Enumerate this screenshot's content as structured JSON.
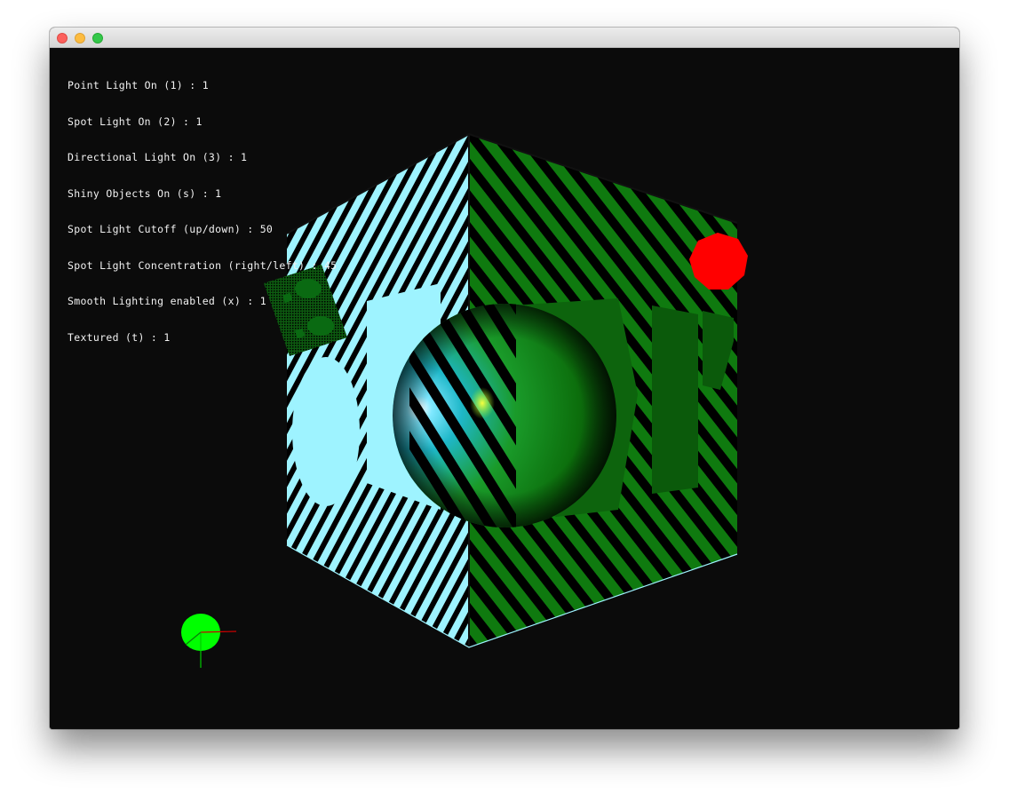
{
  "window": {
    "controls": [
      "close",
      "minimize",
      "zoom"
    ]
  },
  "hud": {
    "lines": [
      "Point Light On (1) : 1",
      "Spot Light On (2) : 1",
      "Directional Light On (3) : 1",
      "Shiny Objects On (s) : 1",
      "Spot Light Cutoff (up/down) : 50",
      "Spot Light Concentration (right/left) : 45",
      "Smooth Lighting enabled (x) : 1",
      "Textured (t) : 1"
    ]
  },
  "scene": {
    "objects": [
      "textured-cube",
      "shiny-sphere",
      "point-light-marker",
      "small-textured-card",
      "axis-gizmo"
    ],
    "colors": {
      "background": "#0b0b0b",
      "cube_left_face": "#9ef3ff",
      "cube_right_face": "#0f7a0f",
      "stripes": "#000000",
      "point_light": "#ff0000",
      "gizmo_sphere": "#00ff00",
      "axis_x": "#cc0000",
      "axis_y": "#00cc00"
    }
  }
}
